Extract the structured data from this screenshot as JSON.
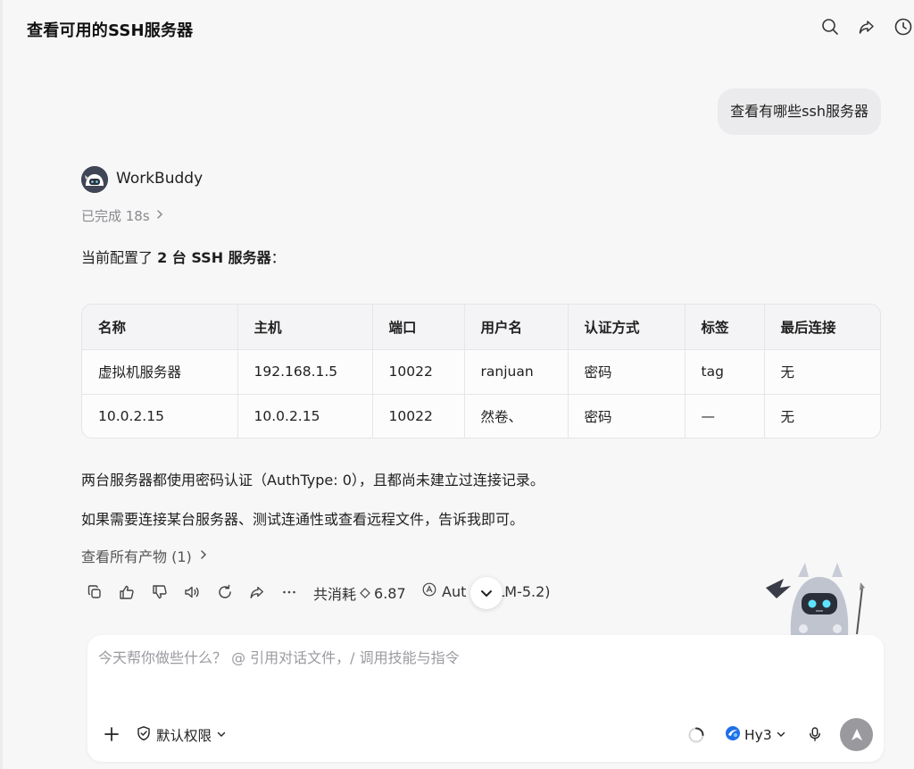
{
  "header": {
    "title": "查看可用的SSH服务器",
    "icons": [
      "search-icon",
      "share-icon",
      "history-icon"
    ]
  },
  "user_message": "查看有哪些ssh服务器",
  "agent": {
    "name": "WorkBuddy",
    "status": "已完成 18s",
    "intro_pre": "当前配置了 ",
    "intro_bold": "2 台 SSH 服务器",
    "intro_post": "："
  },
  "table": {
    "headers": [
      "名称",
      "主机",
      "端口",
      "用户名",
      "认证方式",
      "标签",
      "最后连接"
    ],
    "rows": [
      [
        "虚拟机服务器",
        "192.168.1.5",
        "10022",
        "ranjuan",
        "密码",
        "tag",
        "无"
      ],
      [
        "10.0.2.15",
        "10.0.2.15",
        "10022",
        "然卷、",
        "密码",
        "—",
        "无"
      ]
    ]
  },
  "summary": "两台服务器都使用密码认证（AuthType: 0），且都尚未建立过连接记录。",
  "followup": "如果需要连接某台服务器、测试连通性或查看远程文件，告诉我即可。",
  "artifacts_label": "查看所有产物 (1)",
  "actions": {
    "usage_label": "共消耗",
    "usage_value": "6.87",
    "model_info_left": "Aut",
    "model_info_right": "LM-5.2)",
    "icons": [
      "copy-icon",
      "thumbs-up-icon",
      "thumbs-down-icon",
      "speaker-icon",
      "retry-icon",
      "share-icon",
      "more-icon"
    ]
  },
  "composer": {
    "placeholder": "今天帮你做些什么？ @ 引用对话文件，/ 调用技能与指令",
    "permission_label": "默认权限",
    "model_label": "Hy3"
  }
}
